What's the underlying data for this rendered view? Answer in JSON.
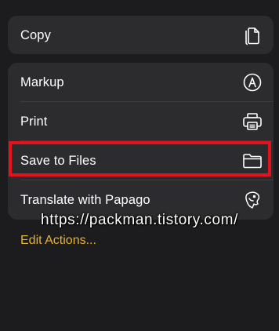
{
  "menu": {
    "copy_label": "Copy",
    "markup_label": "Markup",
    "print_label": "Print",
    "save_label": "Save to Files",
    "translate_label": "Translate with Papago"
  },
  "edit_actions": "Edit Actions...",
  "watermark": "https://packman.tistory.com/",
  "icons": {
    "copy": "copy-icon",
    "markup": "markup-icon",
    "print": "printer-icon",
    "save": "folder-icon",
    "translate": "papago-icon"
  },
  "colors": {
    "background": "#1c1c1e",
    "card": "#2c2c2e",
    "highlight": "#e8101c",
    "accent": "#e7b22e"
  }
}
